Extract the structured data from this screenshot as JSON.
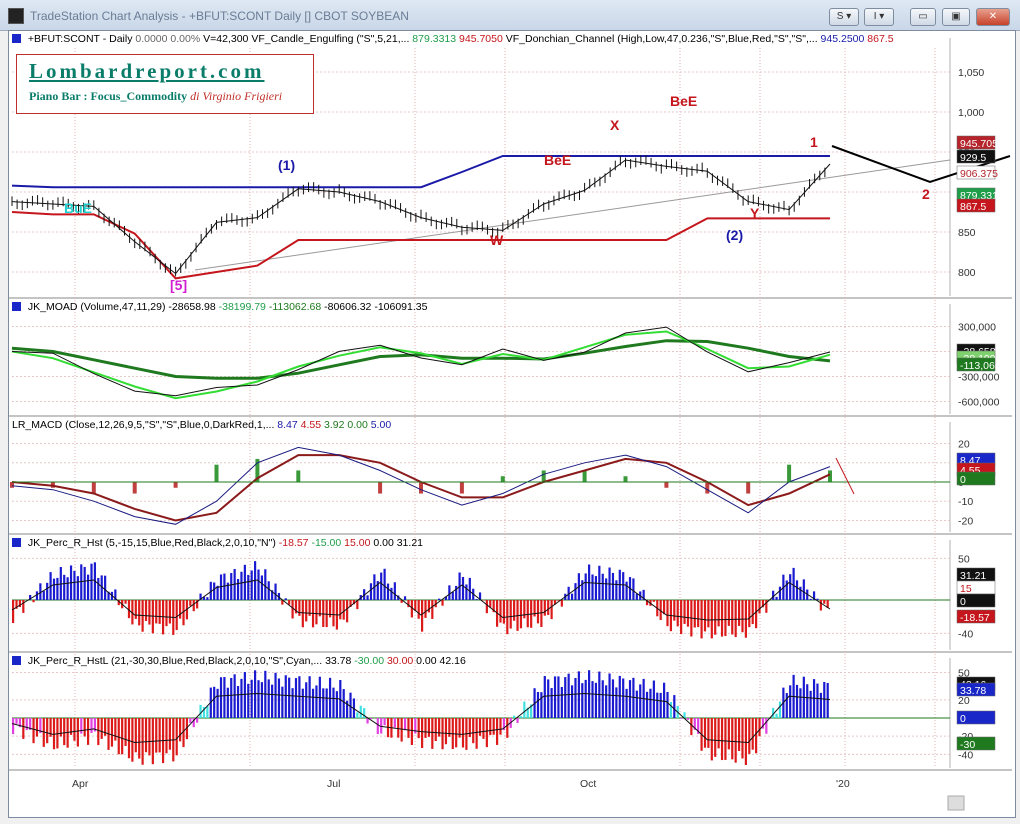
{
  "window": {
    "title": "TradeStation Chart Analysis - +BFUT:SCONT Daily [] CBOT SOYBEAN",
    "buttons": [
      "S ▾",
      "I ▾",
      "▭",
      "▣",
      "✕"
    ]
  },
  "brand": {
    "site": "Lombardreport.com",
    "subtitle": "Piano Bar : Focus_Commodity",
    "author": "di Virginio Frigieri"
  },
  "colors": {
    "price_bar": "#111111",
    "donchian_upper": "#1a1aa8",
    "donchian_lower": "#c4161c",
    "moad_fast": "#33dd33",
    "moad_slow": "#1f7a1f",
    "macd": "#1a1a80",
    "macd_signal": "#8b1a1a",
    "hist_up": "#1a1ad0",
    "hist_down": "#dd1a1a",
    "hist_magenta": "#e040e0",
    "hist_cyan": "#40e0e0"
  },
  "chart_data": [
    {
      "panel": "price",
      "type": "line",
      "header": {
        "symbol": "+BFUT:SCONT - Daily",
        "change": "0.0000",
        "change_pct": "0.00%",
        "volume": "V=42,300",
        "ind1_label": "VF_Candle_Engulfing (\"S\",5,21,...",
        "ind1_v1": "879.3313",
        "ind1_v2": "945.7050",
        "ind2_label": "VF_Donchian_Channel (High,Low,47,0.236,\"S\",Blue,Red,\"S\",\"S\",...",
        "ind2_v1": "945.2500",
        "ind2_v2": "867.5"
      },
      "x": [
        0,
        10,
        20,
        30,
        40,
        50,
        60,
        70,
        80,
        90,
        100,
        110,
        120,
        130,
        140,
        150,
        160,
        170,
        180,
        190,
        200
      ],
      "close": [
        888,
        885,
        882,
        838,
        798,
        862,
        868,
        904,
        900,
        888,
        868,
        856,
        852,
        885,
        902,
        940,
        932,
        926,
        888,
        878,
        935
      ],
      "donchian_upper": [
        908,
        906,
        906,
        906,
        906,
        906,
        906,
        906,
        906,
        906,
        906,
        925,
        945,
        945,
        945,
        945,
        945,
        945,
        945,
        945,
        945
      ],
      "donchian_lower": [
        875,
        872,
        872,
        848,
        792,
        800,
        808,
        840,
        840,
        840,
        840,
        840,
        840,
        840,
        840,
        840,
        840,
        867,
        867,
        867,
        867
      ],
      "yticks": [
        "1,050",
        "1,000",
        "950",
        "900",
        "850",
        "800"
      ],
      "ylim": [
        770,
        1080
      ],
      "price_tags": [
        {
          "label": "945.705",
          "color": "#ffffff",
          "bg": "#b4242a"
        },
        {
          "label": "929.5",
          "color": "#ffffff",
          "bg": "#111111"
        },
        {
          "label": "906.375",
          "color": "#b4242a",
          "bg": "#ffffff"
        },
        {
          "label": "879.3313",
          "color": "#ffffff",
          "bg": "#1f9e4a"
        },
        {
          "label": "867.5",
          "color": "#ffffff",
          "bg": "#c4161c"
        }
      ],
      "annotations": [
        {
          "text": "BuE",
          "color": "#22d0d0"
        },
        {
          "text": "[5]",
          "color": "#d020d0"
        },
        {
          "text": "(1)",
          "color": "#1a1aa8"
        },
        {
          "text": "BeE",
          "color": "#c4161c"
        },
        {
          "text": "W",
          "color": "#c4161c"
        },
        {
          "text": "X",
          "color": "#c4161c"
        },
        {
          "text": "BeE",
          "color": "#c4161c"
        },
        {
          "text": "1",
          "color": "#c4161c"
        },
        {
          "text": "Y",
          "color": "#c4161c"
        },
        {
          "text": "(2)",
          "color": "#1a1aa8"
        },
        {
          "text": "2",
          "color": "#c4161c"
        }
      ]
    },
    {
      "panel": "moad",
      "type": "line",
      "header": {
        "label": "JK_MOAD (Volume,47,11,29)",
        "v1": "-28658.98",
        "v2": "-38199.79",
        "v3": "-113062.68",
        "v4": "-80606.32",
        "v5": "-106091.35"
      },
      "x": [
        0,
        10,
        20,
        30,
        40,
        50,
        60,
        70,
        80,
        90,
        100,
        110,
        120,
        130,
        140,
        150,
        160,
        170,
        180,
        190,
        200
      ],
      "fast": [
        0,
        -80000,
        -250000,
        -420000,
        -560000,
        -480000,
        -360000,
        -180000,
        -50000,
        50000,
        -20000,
        -150000,
        -30000,
        -100000,
        50000,
        200000,
        240000,
        30000,
        -200000,
        -180000,
        -38000
      ],
      "slow": [
        40000,
        0,
        -100000,
        -200000,
        -300000,
        -320000,
        -320000,
        -260000,
        -160000,
        -60000,
        -40000,
        -80000,
        -80000,
        -90000,
        -20000,
        60000,
        130000,
        120000,
        40000,
        -60000,
        -113000
      ],
      "yticks": [
        "300,000",
        "0",
        "-300,000",
        "-600,000"
      ],
      "tags": [
        {
          "label": "-28,658.9",
          "bg": "#111111"
        },
        {
          "label": "-38,199",
          "bg": "#7fd06f"
        },
        {
          "label": "-113,062",
          "bg": "#1f7a1f"
        }
      ]
    },
    {
      "panel": "macd",
      "type": "line",
      "header": {
        "label": "LR_MACD (Close,12,26,9,5,\"S\",\"S\",Blue,0,DarkRed,1,...",
        "v1": "8.47",
        "v2": "4.55",
        "v3": "3.92",
        "v4": "0.00",
        "v5": "5.00"
      },
      "x": [
        0,
        10,
        20,
        30,
        40,
        50,
        60,
        70,
        80,
        90,
        100,
        110,
        120,
        130,
        140,
        150,
        160,
        170,
        180,
        190,
        200
      ],
      "macd": [
        -2,
        -4,
        -10,
        -18,
        -22,
        -10,
        10,
        18,
        14,
        6,
        -4,
        -12,
        -6,
        4,
        10,
        14,
        8,
        -4,
        -16,
        0,
        8
      ],
      "signal": [
        0,
        -2,
        -6,
        -14,
        -20,
        -16,
        2,
        14,
        14,
        10,
        0,
        -8,
        -8,
        0,
        6,
        12,
        10,
        0,
        -12,
        -6,
        4
      ],
      "yticks": [
        "20",
        "10",
        "0",
        "-10",
        "-20"
      ],
      "tags": [
        {
          "label": "8.47",
          "bg": "#1a27c8"
        },
        {
          "label": "4.55",
          "bg": "#c4161c"
        },
        {
          "label": "0",
          "bg": "#1f7a1f"
        }
      ]
    },
    {
      "panel": "perc_r",
      "type": "bar",
      "header": {
        "label": "JK_Perc_R_Hst (5,-15,15,Blue,Red,Black,2,0,10,\"N\")",
        "v1": "-18.57",
        "v2": "-15.00",
        "v3": "15.00",
        "v4": "0.00",
        "v5": "31.21"
      },
      "x": [
        0,
        10,
        20,
        30,
        40,
        50,
        60,
        70,
        80,
        90,
        100,
        110,
        120,
        130,
        140,
        150,
        160,
        170,
        180,
        190,
        200
      ],
      "values": [
        -20,
        30,
        40,
        -30,
        -35,
        25,
        40,
        -25,
        -30,
        35,
        -30,
        30,
        -35,
        -25,
        35,
        30,
        -30,
        -40,
        -38,
        35,
        -18
      ],
      "yticks": [
        "50",
        "0",
        "-40"
      ],
      "tags": [
        {
          "label": "31.21",
          "bg": "#111111"
        },
        {
          "label": "15",
          "bg": "#ffffff"
        },
        {
          "label": "0",
          "bg": "#111111"
        },
        {
          "label": "-18.57",
          "bg": "#c4161c"
        }
      ]
    },
    {
      "panel": "perc_rl",
      "type": "bar",
      "header": {
        "label": "JK_Perc_R_HstL (21,-30,30,Blue,Red,Black,2,0,10,\"S\",Cyan,...",
        "v1": "33.78",
        "v2": "-30.00",
        "v3": "30.00",
        "v4": "0.00",
        "v5": "42.16"
      },
      "x": [
        0,
        10,
        20,
        30,
        40,
        50,
        60,
        70,
        80,
        90,
        100,
        110,
        120,
        130,
        140,
        150,
        160,
        170,
        180,
        190,
        200
      ],
      "values": [
        -10,
        -30,
        -20,
        -45,
        -40,
        40,
        45,
        40,
        35,
        -15,
        -25,
        -30,
        -20,
        40,
        45,
        40,
        30,
        -40,
        -45,
        40,
        34
      ],
      "yticks": [
        "50",
        "20",
        "0",
        "-20",
        "-40"
      ],
      "tags": [
        {
          "label": "42.16",
          "bg": "#111111"
        },
        {
          "label": "33.78",
          "bg": "#1a27c8"
        },
        {
          "label": "0",
          "bg": "#1a27c8"
        },
        {
          "label": "-30",
          "bg": "#1f7a1f"
        }
      ]
    }
  ],
  "x_axis": {
    "labels": [
      "Apr",
      "Jul",
      "Oct",
      "'20"
    ]
  }
}
